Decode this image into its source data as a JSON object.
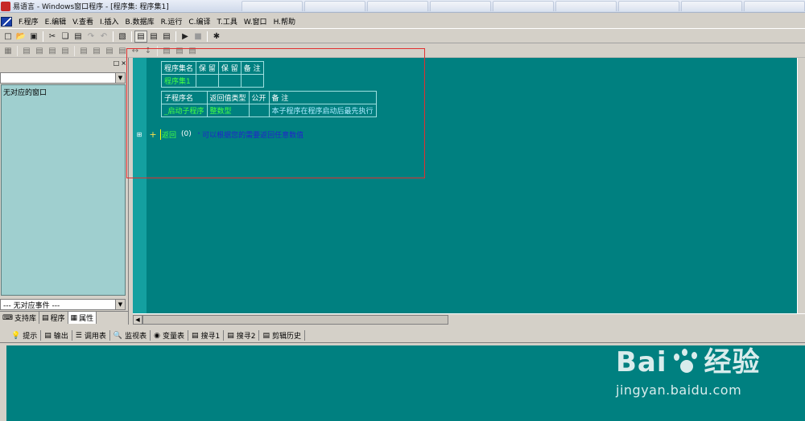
{
  "window": {
    "title": "易语言 - Windows窗口程序 - [程序集: 程序集1]"
  },
  "menu": [
    "F.程序",
    "E.编辑",
    "V.查看",
    "I.插入",
    "B.数据库",
    "R.运行",
    "C.编译",
    "T.工具",
    "W.窗口",
    "H.帮助"
  ],
  "toolbar1": [
    "new-icon",
    "open-icon",
    "save-icon",
    "cut-icon",
    "copy-icon",
    "paste-icon",
    "redo-icon",
    "undo-icon",
    "find-icon",
    "layout1-icon",
    "layout2-icon",
    "layout3-icon",
    "run-icon",
    "stop-icon",
    "debug-icon"
  ],
  "left": {
    "combo_top": "",
    "tree_text": "无对应的窗口",
    "combo_bottom": "--- 无对应事件 ---",
    "tabs": [
      "支持库",
      "程序",
      "属性"
    ]
  },
  "editor": {
    "assembly_table": {
      "headers": [
        "程序集名",
        "保 留",
        "保 留",
        "备 注"
      ],
      "row": [
        "程序集1",
        "",
        "",
        ""
      ]
    },
    "sub_table": {
      "headers": [
        "子程序名",
        "返回值类型",
        "公开",
        "备 注"
      ],
      "row": [
        "_启动子程序",
        "整数型",
        "",
        "本子程序在程序启动后最先执行"
      ]
    },
    "code": {
      "keyword": "返回",
      "args": "(0)",
      "comment": "' 可以根据您的需要返回任意数值"
    }
  },
  "bottom_tabs": [
    {
      "icon": "hint-icon",
      "label": "提示"
    },
    {
      "icon": "output-icon",
      "label": "输出"
    },
    {
      "icon": "calltable-icon",
      "label": "调用表"
    },
    {
      "icon": "monitor-icon",
      "label": "监视表"
    },
    {
      "icon": "variable-icon",
      "label": "变量表"
    },
    {
      "icon": "search-icon",
      "label": "搜寻1"
    },
    {
      "icon": "search-icon",
      "label": "搜寻2"
    },
    {
      "icon": "clipboard-icon",
      "label": "剪辑历史"
    }
  ],
  "watermark": {
    "brand": "Bai",
    "brand2": "经验",
    "url": "jingyan.baidu.com"
  },
  "colors": {
    "editor_bg": "#008080",
    "keyword": "#44ff44",
    "comment": "#2222cc",
    "highlight_box": "#e23030"
  }
}
